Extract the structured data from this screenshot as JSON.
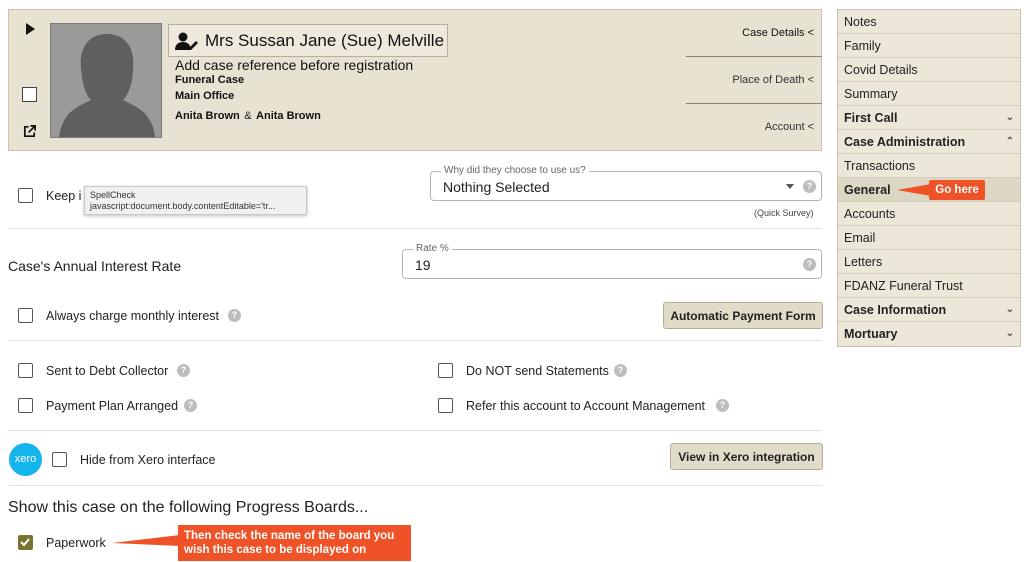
{
  "header": {
    "name": "Mrs Sussan Jane (Sue) Melville",
    "case_ref": "Add case reference before registration",
    "case_type": "Funeral Case",
    "office": "Main Office",
    "arranger1": "Anita Brown",
    "amp": "&",
    "arranger2": "Anita Brown",
    "links": [
      "Case Details <",
      "Place of Death <",
      "Account <"
    ]
  },
  "tooltip": {
    "line1": "SpellCheck",
    "line2": "javascript:document.body.contentEditable='tr..."
  },
  "keep_label": "Keep i",
  "survey": {
    "legend": "Why did they choose to use us?",
    "value": "Nothing Selected",
    "caption": "(Quick Survey)"
  },
  "interest": {
    "label": "Case's Annual Interest Rate",
    "legend": "Rate %",
    "value": "19"
  },
  "options": {
    "always_charge": "Always charge monthly interest",
    "auto_payment_button": "Automatic Payment Form",
    "debt_collector": "Sent to Debt Collector",
    "no_statements": "Do NOT send Statements",
    "payment_plan": "Payment Plan Arranged",
    "refer_account": "Refer this account to Account Management"
  },
  "xero": {
    "logo_text": "xero",
    "hide_label": "Hide from Xero interface",
    "view_button": "View in Xero integration"
  },
  "progress": {
    "title": "Show this case on the following Progress Boards...",
    "board_label": "Paperwork",
    "board_checked": true
  },
  "callouts": {
    "go_here": "Go here",
    "check_board_line1": "Then check the name of the board you",
    "check_board_line2": "wish this case to be displayed on"
  },
  "sidebar": {
    "items": [
      {
        "label": "Notes"
      },
      {
        "label": "Family"
      },
      {
        "label": "Covid Details"
      },
      {
        "label": "Summary"
      },
      {
        "label": "First Call",
        "chevron": "⌄"
      },
      {
        "label": "Case Administration",
        "chevron": "⌃"
      },
      {
        "label": "Transactions"
      },
      {
        "label": "General"
      },
      {
        "label": "Accounts"
      },
      {
        "label": "Email"
      },
      {
        "label": "Letters"
      },
      {
        "label": "FDANZ Funeral Trust"
      },
      {
        "label": "Case Information",
        "chevron": "⌄"
      },
      {
        "label": "Mortuary",
        "chevron": "⌄"
      }
    ]
  },
  "colors": {
    "header_bg": "#e8e2d3",
    "sidebar_bg": "#ece7d9",
    "button_bg": "#e0dcc8",
    "callout": "#f05228",
    "checkbox_checked": "#7a7330",
    "xero_blue": "#13b5ea"
  }
}
